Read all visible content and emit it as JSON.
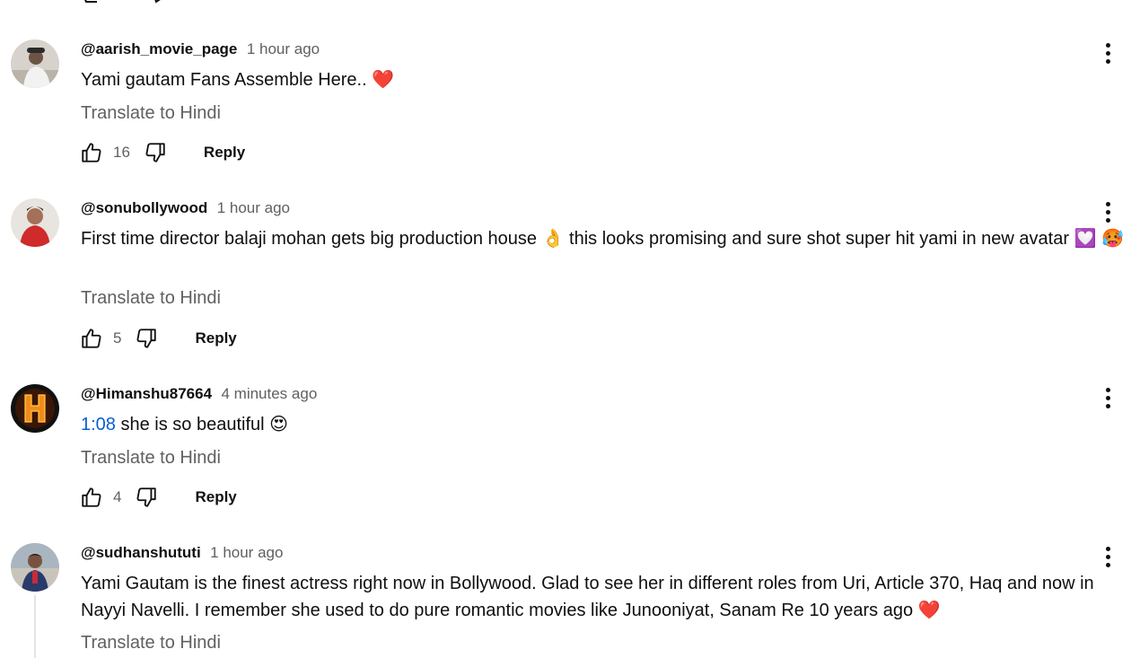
{
  "comments": [
    {
      "author": "@aarish_movie_page",
      "time": "1 hour ago",
      "text": "Yami gautam Fans Assemble Here.. ❤️",
      "translate": "Translate to Hindi",
      "likes": "16",
      "reply": "Reply"
    },
    {
      "author": "@sonubollywood",
      "time": "1 hour ago",
      "text": "First time director balaji mohan gets big production house 👌  this looks promising and sure shot super hit yami in new avatar 💟 🥵",
      "translate": "Translate to Hindi",
      "likes": "5",
      "reply": "Reply"
    },
    {
      "author": "@Himanshu87664",
      "time": "4 minutes ago",
      "timestamp_link": "1:08",
      "text": " she is so beautiful 😍",
      "translate": "Translate to Hindi",
      "likes": "4",
      "reply": "Reply"
    },
    {
      "author": "@sudhanshututi",
      "time": "1 hour ago",
      "text": "Yami Gautam is the finest actress right now in Bollywood. Glad to see her in different roles from Uri, Article 370, Haq and now in Nayyi Navelli. I remember she used to do pure romantic movies like Junooniyat, Sanam Re 10 years ago ❤️",
      "translate": "Translate to Hindi"
    }
  ],
  "icons": {
    "like": "thumbs-up-icon",
    "dislike": "thumbs-down-icon",
    "menu": "more-vert-icon"
  },
  "colors": {
    "link": "#065fd4",
    "secondary_text": "#606060",
    "primary_text": "#0f0f0f"
  }
}
